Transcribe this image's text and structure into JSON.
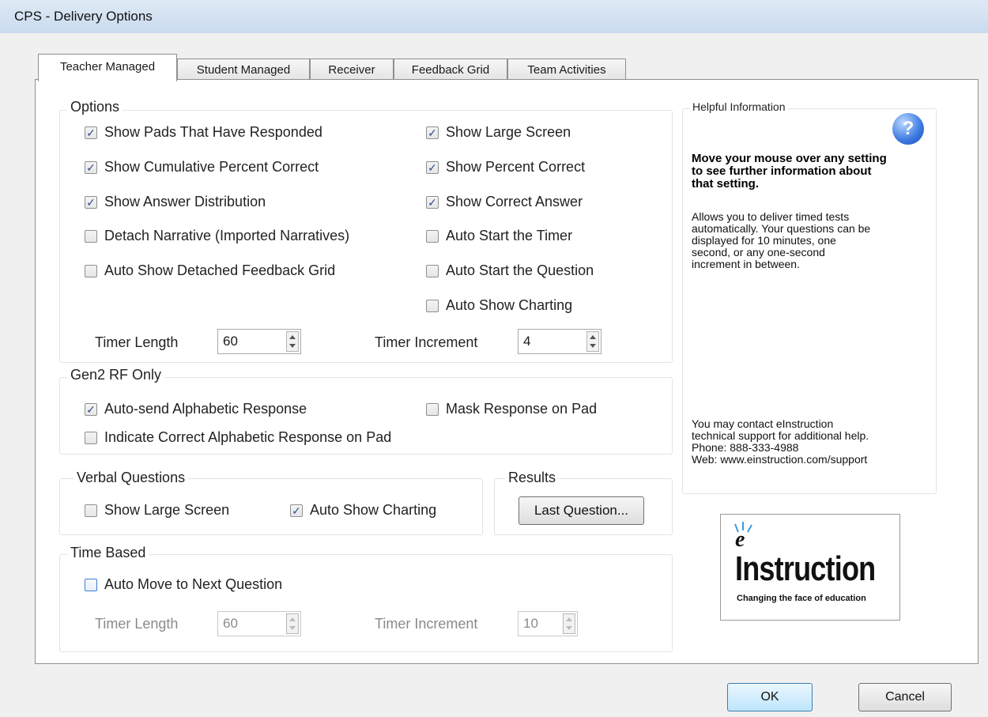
{
  "window": {
    "title": "CPS - Delivery Options"
  },
  "tabs": [
    {
      "label": "Teacher Managed",
      "active": true
    },
    {
      "label": "Student Managed",
      "active": false
    },
    {
      "label": "Receiver",
      "active": false
    },
    {
      "label": "Feedback Grid",
      "active": false
    },
    {
      "label": "Team Activities",
      "active": false
    }
  ],
  "options": {
    "title": "Options",
    "left": [
      {
        "label": "Show Pads That Have Responded",
        "checked": true
      },
      {
        "label": "Show Cumulative Percent Correct",
        "checked": true
      },
      {
        "label": "Show Answer Distribution",
        "checked": true
      },
      {
        "label": "Detach Narrative (Imported Narratives)",
        "checked": false
      },
      {
        "label": "Auto Show Detached Feedback Grid",
        "checked": false
      }
    ],
    "right": [
      {
        "label": "Show Large Screen",
        "checked": true
      },
      {
        "label": "Show Percent Correct",
        "checked": true
      },
      {
        "label": "Show Correct Answer",
        "checked": true
      },
      {
        "label": "Auto Start the Timer",
        "checked": false
      },
      {
        "label": "Auto Start the Question",
        "checked": false
      },
      {
        "label": "Auto Show Charting",
        "checked": false
      }
    ],
    "timer_length_label": "Timer Length",
    "timer_length": "60",
    "timer_increment_label": "Timer Increment",
    "timer_increment": "4"
  },
  "gen2": {
    "title": "Gen2 RF Only",
    "auto_send": {
      "label": "Auto-send  Alphabetic Response",
      "checked": true
    },
    "mask": {
      "label": "Mask Response on Pad",
      "checked": false
    },
    "indicate": {
      "label": "Indicate Correct Alphabetic Response on Pad",
      "checked": false
    }
  },
  "verbal": {
    "title": "Verbal Questions",
    "large_screen": {
      "label": "Show Large Screen",
      "checked": false
    },
    "charting": {
      "label": "Auto Show Charting",
      "checked": true
    }
  },
  "results": {
    "title": "Results",
    "last_question": "Last Question..."
  },
  "time_based": {
    "title": "Time Based",
    "auto_move": {
      "label": "Auto Move to Next Question",
      "checked": false
    },
    "timer_length_label": "Timer Length",
    "timer_length": "60",
    "timer_increment_label": "Timer Increment",
    "timer_increment": "10"
  },
  "help": {
    "title": "Helpful Information",
    "icon": "question-icon",
    "bold": [
      "Move your mouse over any setting",
      "to see further information about",
      "that setting."
    ],
    "body": [
      "Allows you to deliver timed tests",
      "automatically. Your questions can be",
      "displayed for 10 minutes, one",
      "second, or any one-second",
      "increment in between."
    ],
    "contact": [
      "You may contact eInstruction",
      "technical support for additional help.",
      "Phone: 888-333-4988",
      "Web: www.einstruction.com/support"
    ]
  },
  "logo": {
    "e": "e",
    "word": "Instruction",
    "tagline": "Changing the face of education",
    "tm": "."
  },
  "buttons": {
    "ok": "OK",
    "cancel": "Cancel"
  },
  "colors": {
    "title_bar": "#c9dbee",
    "check_mark": "#2b4a86",
    "help_icon": "#3a78e0"
  }
}
